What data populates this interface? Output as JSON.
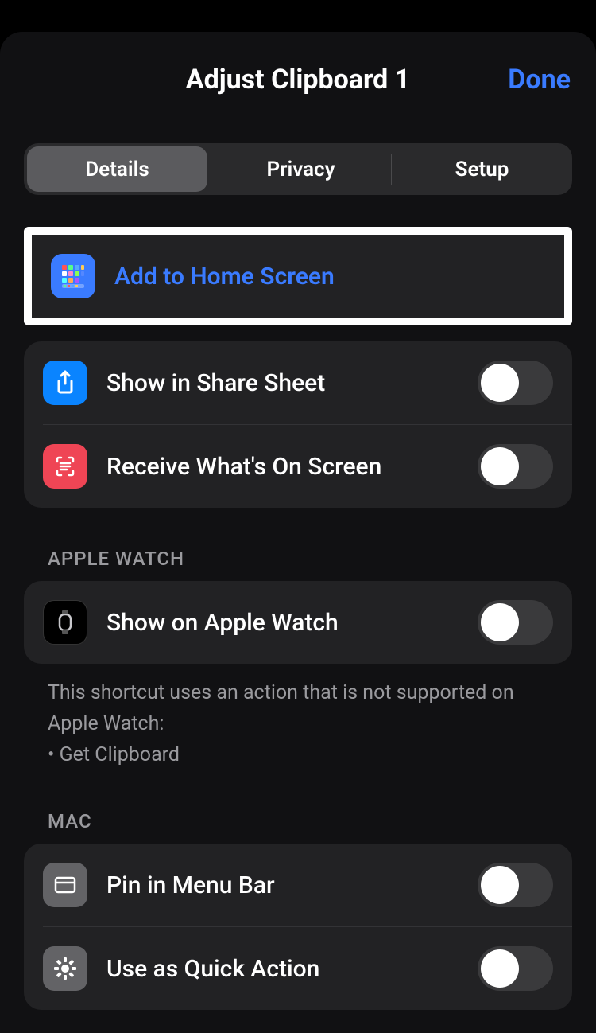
{
  "header": {
    "title": "Adjust Clipboard 1",
    "done": "Done"
  },
  "tabs": {
    "details": "Details",
    "privacy": "Privacy",
    "setup": "Setup"
  },
  "rows": {
    "add_home": "Add to Home Screen",
    "share_sheet": "Show in Share Sheet",
    "receive_screen": "Receive What's On Screen",
    "show_watch": "Show on Apple Watch",
    "pin_menu": "Pin in Menu Bar",
    "quick_action": "Use as Quick Action"
  },
  "sections": {
    "watch_header": "APPLE WATCH",
    "mac_header": "MAC",
    "watch_footer_line1": "This shortcut uses an action that is not supported on Apple Watch:",
    "watch_footer_line2": "• Get Clipboard"
  },
  "toggles": {
    "share_sheet": false,
    "receive_screen": false,
    "show_watch": false,
    "pin_menu": false,
    "quick_action": false
  },
  "colors": {
    "accent": "#3a7bff",
    "red": "#ef4555",
    "gray": "#636366"
  }
}
